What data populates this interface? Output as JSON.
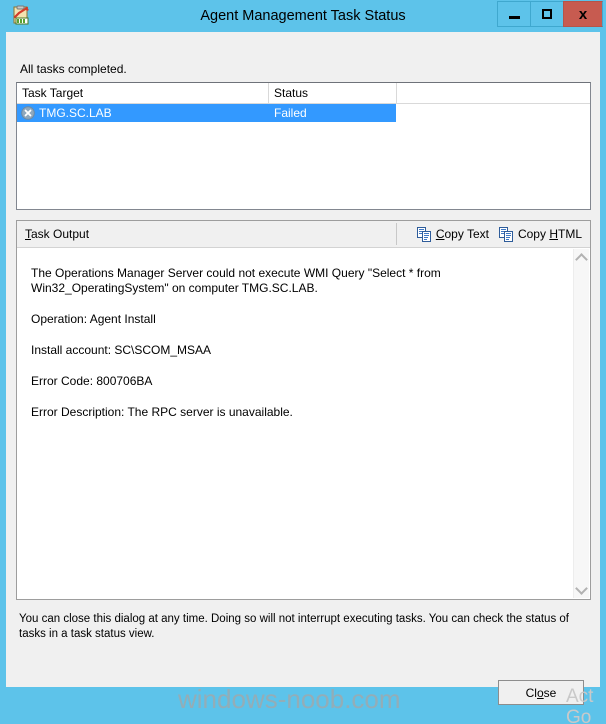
{
  "window": {
    "title": "Agent Management Task Status",
    "icon": "task-status-clipboard-icon",
    "controls": {
      "minimize_label": "–",
      "maximize_label": "□",
      "close_label": "x"
    },
    "titlebar_color": "#5dc3ea",
    "close_button_color": "#c75b50"
  },
  "status": {
    "message": "All tasks completed."
  },
  "task_list": {
    "columns": [
      "Task Target",
      "Status"
    ],
    "rows": [
      {
        "target": "TMG.SC.LAB",
        "status": "Failed",
        "icon": "error-circle-x-icon",
        "selected": true
      }
    ],
    "selection_color": "#3399ff"
  },
  "output": {
    "header_label_before": "T",
    "header_label_after": "ask Output",
    "copy_text": {
      "accel": "C",
      "rest": "opy Text",
      "icon": "copy-documents-icon"
    },
    "copy_html": {
      "before": "Copy ",
      "accel": "H",
      "after": "TML",
      "icon": "copy-documents-icon"
    },
    "paragraphs": [
      "The Operations Manager Server could not execute WMI Query \"Select * from Win32_OperatingSystem\" on computer TMG.SC.LAB.",
      "Operation: Agent Install",
      "Install account: SC\\SCOM_MSAA",
      "Error Code: 800706BA",
      "Error Description: The RPC server is unavailable."
    ],
    "scrollbar": {
      "up_icon": "chevron-up-icon",
      "down_icon": "chevron-down-icon"
    }
  },
  "footer": {
    "note": "You can close this dialog at any time. Doing so will not interrupt executing tasks. You can check the status of tasks in a task status view."
  },
  "close_button": {
    "before": "Cl",
    "accel": "o",
    "after": "se"
  },
  "watermarks": {
    "site": "windows-noob.com",
    "activate": "Act Go"
  }
}
